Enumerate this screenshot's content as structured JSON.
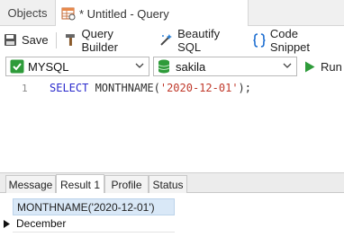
{
  "tabs": {
    "objects": "Objects",
    "query": "* Untitled - Query"
  },
  "toolbar": {
    "save": "Save",
    "query_builder": "Query Builder",
    "beautify": "Beautify SQL",
    "code_snippet": "Code Snippet"
  },
  "connection": {
    "selected": "MYSQL",
    "database": "sakila",
    "run": "Run"
  },
  "editor": {
    "line_number": "1",
    "keyword": "SELECT",
    "function": " MONTHNAME(",
    "string": "'2020-12-01'",
    "tail": ");"
  },
  "result_tabs": [
    "Message",
    "Result 1",
    "Profile",
    "Status"
  ],
  "grid": {
    "column": "MONTHNAME('2020-12-01')",
    "rows": [
      "December"
    ]
  },
  "colors": {
    "accent_green": "#2e9b3a",
    "keyword_blue": "#2a2acc",
    "string_red": "#c0392b",
    "header_blue": "#d9e8f7"
  }
}
